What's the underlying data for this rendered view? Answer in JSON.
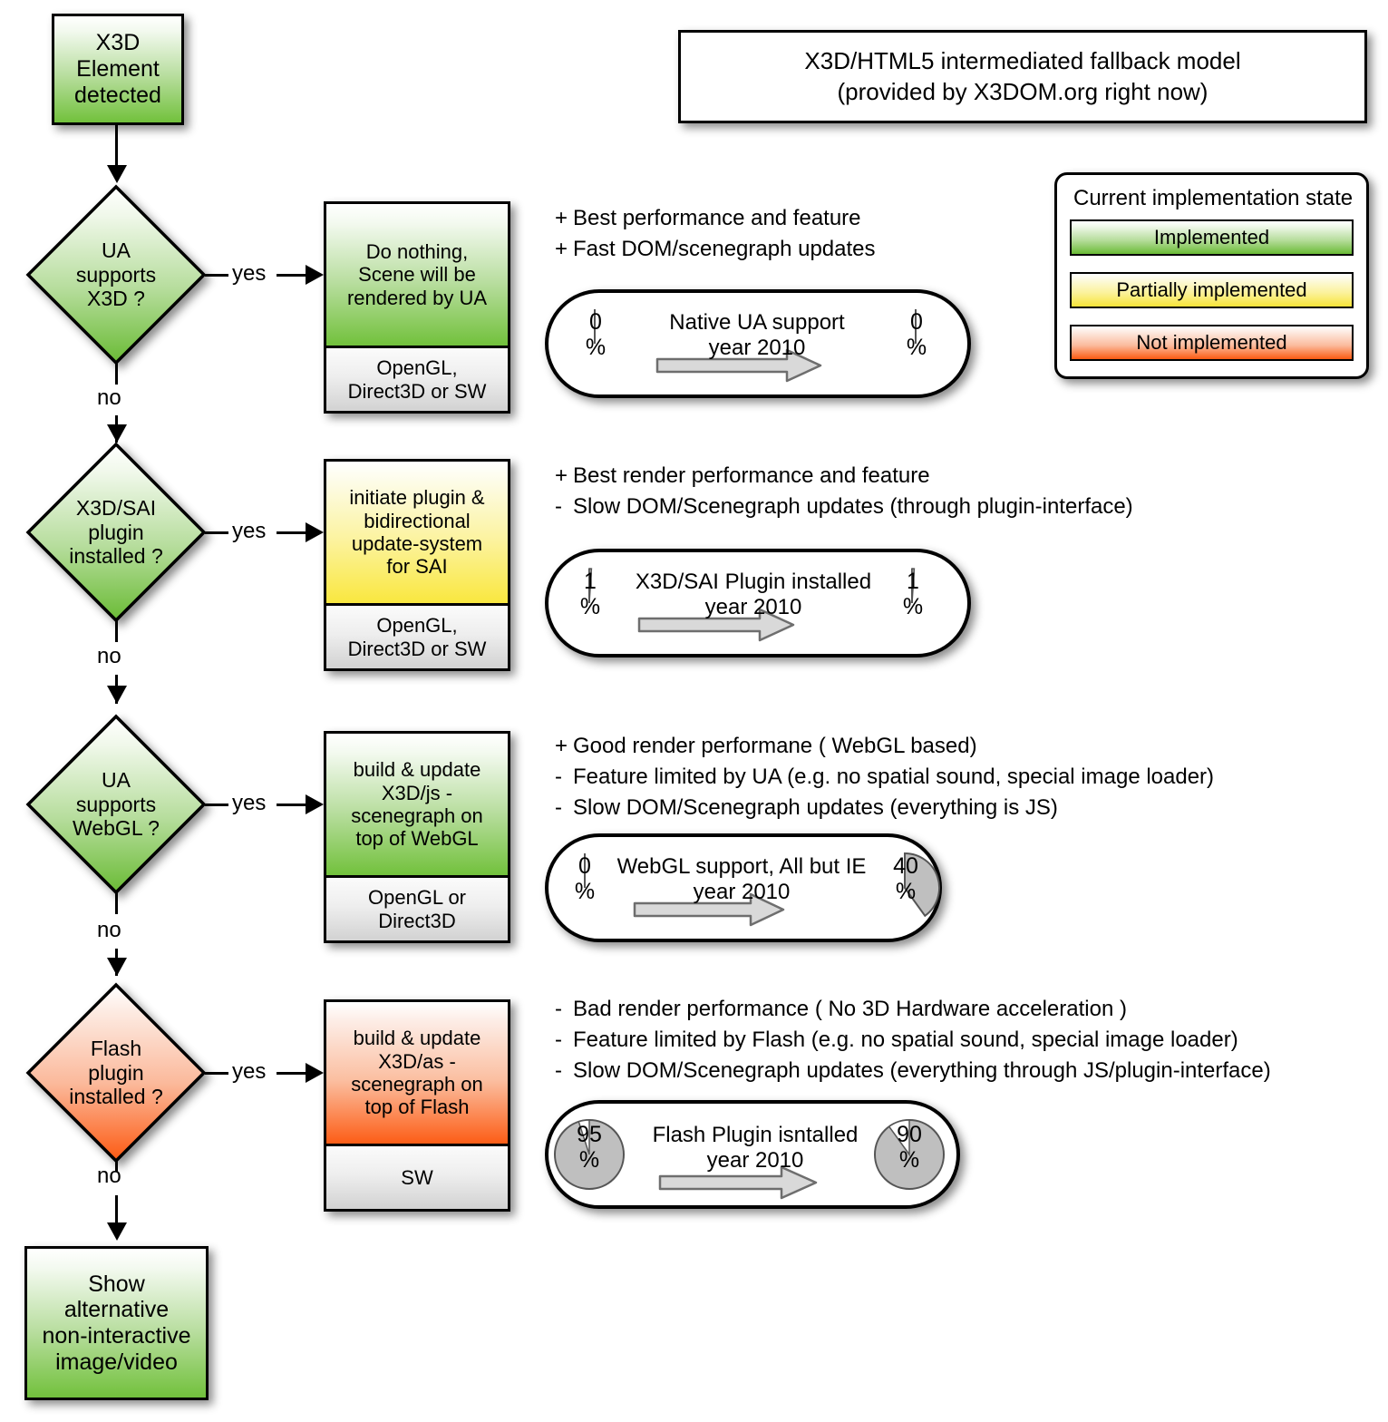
{
  "title": {
    "line1": "X3D/HTML5 intermediated fallback model",
    "line2": "(provided by X3DOM.org right now)"
  },
  "legend": {
    "heading": "Current implementation state",
    "items": [
      {
        "label": "Implemented",
        "color": "#72c13c"
      },
      {
        "label": "Partially implemented",
        "color": "#f9e73f"
      },
      {
        "label": "Not implemented",
        "color": "#fc5d16"
      }
    ]
  },
  "start_node": {
    "line1": "X3D",
    "line2": "Element",
    "line3": "detected"
  },
  "end_node": {
    "line1": "Show",
    "line2": "alternative",
    "line3": "non-interactive",
    "line4": "image/video"
  },
  "edge_labels": {
    "yes": "yes",
    "no": "no"
  },
  "rows": [
    {
      "decision": {
        "line1": "UA",
        "line2": "supports",
        "line3": "X3D ?",
        "state": "implemented"
      },
      "action": {
        "lines": [
          "Do nothing,",
          "Scene will be",
          "rendered by UA"
        ],
        "footer": [
          "OpenGL,",
          "Direct3D or SW"
        ],
        "state": "implemented"
      },
      "bullets": [
        {
          "sign": "+",
          "text": "Best performance and feature"
        },
        {
          "sign": "+",
          "text": "Fast DOM/scenegraph updates"
        }
      ],
      "capsule": {
        "title": "Native UA support",
        "subtitle": "year 2010",
        "left_value": "0",
        "left_unit": "%",
        "right_value": "0",
        "right_unit": "%",
        "left_pct": 0,
        "right_pct": 0
      }
    },
    {
      "decision": {
        "line1": "X3D/SAI",
        "line2": "plugin",
        "line3": "installed ?",
        "state": "implemented"
      },
      "action": {
        "lines": [
          "initiate plugin &",
          "bidirectional",
          "update-system",
          "for SAI"
        ],
        "footer": [
          "OpenGL,",
          "Direct3D or SW"
        ],
        "state": "partially-implemented"
      },
      "bullets": [
        {
          "sign": "+",
          "text": "Best render performance and feature"
        },
        {
          "sign": "-",
          "text": "Slow DOM/Scenegraph updates (through plugin-interface)"
        }
      ],
      "capsule": {
        "title": "X3D/SAI Plugin installed",
        "subtitle": "year 2010",
        "left_value": "1",
        "left_unit": "%",
        "right_value": "1",
        "right_unit": "%",
        "left_pct": 1,
        "right_pct": 1
      }
    },
    {
      "decision": {
        "line1": "UA",
        "line2": "supports",
        "line3": "WebGL ?",
        "state": "implemented"
      },
      "action": {
        "lines": [
          "build & update",
          "X3D/js -",
          "scenegraph on",
          "top of WebGL"
        ],
        "footer": [
          "OpenGL or",
          "Direct3D"
        ],
        "state": "implemented"
      },
      "bullets": [
        {
          "sign": "+",
          "text": "Good render performane ( WebGL based)"
        },
        {
          "sign": "-",
          "text": "Feature limited by UA (e.g. no spatial sound, special image loader)"
        },
        {
          "sign": "-",
          "text": "Slow DOM/Scenegraph updates (everything is JS)"
        }
      ],
      "capsule": {
        "title": "WebGL support, All but IE",
        "subtitle": "year 2010",
        "left_value": "0",
        "left_unit": "%",
        "right_value": "40",
        "right_unit": "%",
        "left_pct": 0,
        "right_pct": 40
      }
    },
    {
      "decision": {
        "line1": "Flash",
        "line2": "plugin",
        "line3": "installed ?",
        "state": "not-implemented"
      },
      "action": {
        "lines": [
          "build & update",
          "X3D/as -",
          "scenegraph on",
          "top of Flash"
        ],
        "footer": [
          "SW"
        ],
        "state": "not-implemented"
      },
      "bullets": [
        {
          "sign": "-",
          "text": "Bad render performance ( No 3D Hardware acceleration )"
        },
        {
          "sign": "-",
          "text": "Feature limited by Flash (e.g. no spatial sound, special image loader)"
        },
        {
          "sign": "-",
          "text": "Slow DOM/Scenegraph updates (everything through JS/plugin-interface)"
        }
      ],
      "capsule": {
        "title": "Flash Plugin isntalled",
        "subtitle": "year 2010",
        "left_value": "95",
        "left_unit": "%",
        "right_value": "90",
        "right_unit": "%",
        "left_pct": 95,
        "right_pct": 90
      }
    }
  ]
}
